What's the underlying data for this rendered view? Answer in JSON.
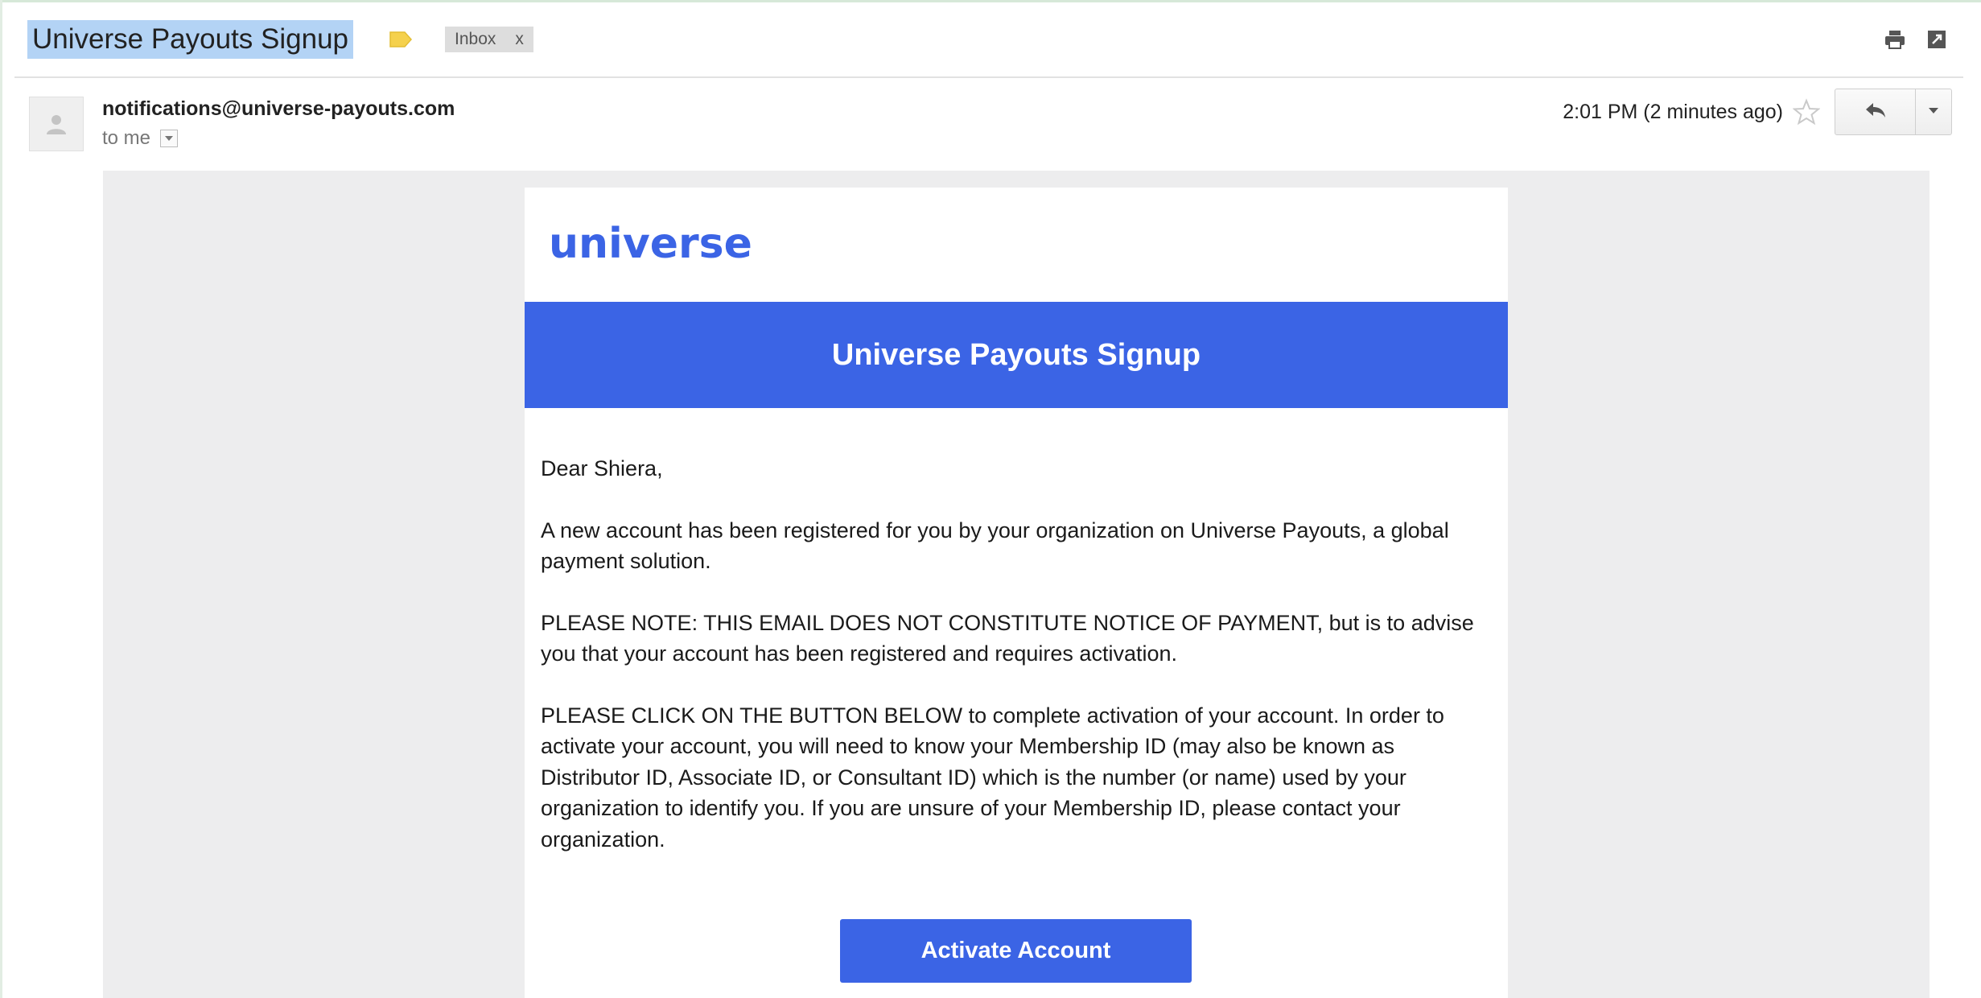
{
  "email": {
    "subject": "Universe Payouts Signup",
    "label_chip": "Inbox",
    "label_chip_close": "x",
    "sender": "notifications@universe-payouts.com",
    "recipient": "to me",
    "timestamp": "2:01 PM (2 minutes ago)"
  },
  "icons": {
    "label_tag": "label-tag-icon",
    "print": "print-icon",
    "new_window": "new-window-icon",
    "avatar": "avatar-icon",
    "star": "star-icon",
    "reply": "reply-icon",
    "more": "chevron-down-icon"
  },
  "body": {
    "logo": "universe",
    "banner_title": "Universe Payouts Signup",
    "greeting": "Dear Shiera,",
    "paragraph_1": "A new account has been registered for you by your organization on Universe Payouts, a global payment solution.",
    "paragraph_2": "PLEASE NOTE: THIS EMAIL DOES NOT CONSTITUTE NOTICE OF PAYMENT, but is to advise you that your account has been registered and requires activation.",
    "paragraph_3": "PLEASE CLICK ON THE BUTTON BELOW to complete activation of your account. In order to activate your account, you will need to know your Membership ID (may also be known as Distributor ID, Associate ID, or Consultant ID) which is the number (or name) used by your organization to identify you. If you are unsure of your Membership ID, please contact your organization.",
    "cta_label": "Activate Account"
  },
  "colors": {
    "brand_blue": "#3b64e5",
    "subject_highlight": "#b3d3f5",
    "label_yellow": "#f5d14d",
    "mail_background": "#ededee"
  }
}
